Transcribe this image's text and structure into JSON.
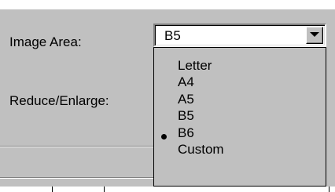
{
  "dialog": {
    "image_area_label": "Image Area:",
    "reduce_enlarge_label": "Reduce/Enlarge:"
  },
  "combo": {
    "selected_value": "B5",
    "dropdown_icon": "chevron-down-icon"
  },
  "list": {
    "items": [
      "Letter",
      "A4",
      "A5",
      "B5",
      "B6",
      "Custom"
    ],
    "selected_index": 3
  },
  "colors": {
    "face": "#c0c0c0",
    "field": "#ffffff",
    "text": "#000000"
  }
}
